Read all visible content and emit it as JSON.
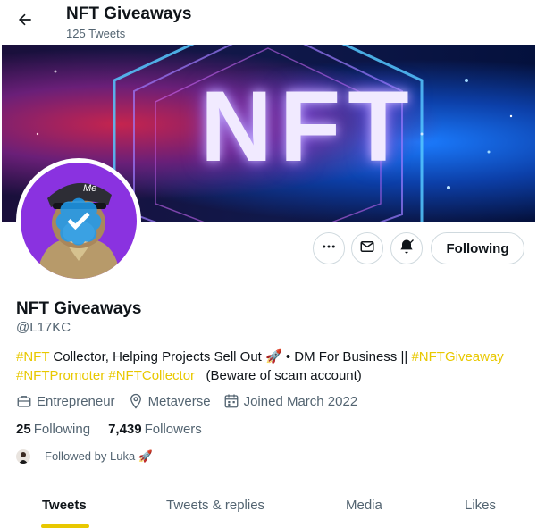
{
  "header": {
    "title": "NFT Giveaways",
    "tweet_count": "125 Tweets",
    "back_icon": "arrow-left-icon"
  },
  "banner": {
    "text": "NFT"
  },
  "profile": {
    "name": "NFT Giveaways",
    "handle": "@L17KC",
    "avatar_cap_text": "Me",
    "bio": [
      {
        "text": "#NFT",
        "tag": true
      },
      {
        "text": " Collector, Helping Projects Sell Out 🚀 • DM For Business || ",
        "tag": false
      },
      {
        "text": "#NFTGiveaway",
        "tag": true
      },
      {
        "text": " ",
        "tag": false
      },
      {
        "text": "#NFTPromoter",
        "tag": true
      },
      {
        "text": " ",
        "tag": false
      },
      {
        "text": "#NFTCollector",
        "tag": true
      },
      {
        "text": "   (Beware of scam account)",
        "tag": false
      }
    ],
    "meta": {
      "category": "Entrepreneur",
      "location": "Metaverse",
      "joined": "Joined March 2022"
    },
    "stats": {
      "following_count": "25",
      "following_label": "Following",
      "followers_count": "7,439",
      "followers_label": "Followers"
    },
    "followed_by": "Followed by Luka 🚀"
  },
  "actions": {
    "follow_label": "Following"
  },
  "tabs": [
    {
      "label": "Tweets",
      "active": true
    },
    {
      "label": "Tweets & replies",
      "active": false
    },
    {
      "label": "Media",
      "active": false
    },
    {
      "label": "Likes",
      "active": false
    }
  ],
  "colors": {
    "accent": "#e8c800",
    "avatar_bg": "#8a32e0",
    "verified": "#1d9bf0"
  }
}
